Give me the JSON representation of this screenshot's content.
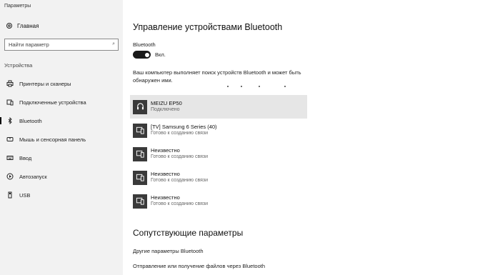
{
  "app": {
    "title": "Параметры"
  },
  "sidebar": {
    "home_label": "Главная",
    "search": {
      "placeholder": "Найти параметр"
    },
    "section_label": "Устройства",
    "items": [
      {
        "label": "Принтеры и сканеры",
        "icon": "printer-icon"
      },
      {
        "label": "Подключенные устройства",
        "icon": "devices-icon"
      },
      {
        "label": "Bluetooth",
        "icon": "bluetooth-icon",
        "active": true
      },
      {
        "label": "Мышь и сенсорная панель",
        "icon": "mouse-icon"
      },
      {
        "label": "Ввод",
        "icon": "keyboard-icon"
      },
      {
        "label": "Автозапуск",
        "icon": "autoplay-icon"
      },
      {
        "label": "USB",
        "icon": "usb-icon"
      }
    ]
  },
  "main": {
    "title": "Управление устройствами Bluetooth",
    "bluetooth_label": "Bluetooth",
    "toggle_state": "Вкл.",
    "discovery_text": "Ваш компьютер выполняет поиск устройств Bluetooth и может быть обнаружен ими.",
    "devices": [
      {
        "name": "MEIZU EP50",
        "status": "Подключено",
        "icon": "headset-icon",
        "selected": true
      },
      {
        "name": "[TV] Samsung 6 Series (40)",
        "status": "Готово к созданию связи",
        "icon": "device-icon"
      },
      {
        "name": "Неизвестно",
        "status": "Готово к созданию связи",
        "icon": "device-icon"
      },
      {
        "name": "Неизвестно",
        "status": "Готово к созданию связи",
        "icon": "device-icon"
      },
      {
        "name": "Неизвестно",
        "status": "Готово к созданию связи",
        "icon": "device-icon"
      }
    ],
    "related_title": "Сопутствующие параметры",
    "links": [
      "Другие параметры Bluetooth",
      "Отправление или получение файлов через Bluetooth"
    ]
  },
  "colors": {
    "accent": "#1a1a1a",
    "selected_bg": "#e6e6e6",
    "sidebar_bg": "#f2f2f2"
  }
}
